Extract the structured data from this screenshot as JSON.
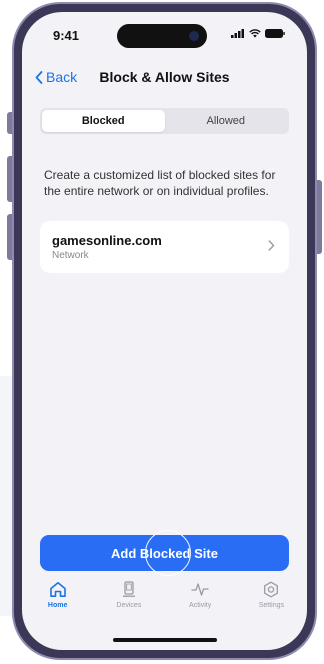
{
  "status_bar": {
    "time": "9:41"
  },
  "nav": {
    "back_label": "Back",
    "title": "Block & Allow Sites"
  },
  "segments": {
    "blocked_label": "Blocked",
    "allowed_label": "Allowed",
    "selected": "Blocked"
  },
  "description": "Create a customized list of blocked sites for the entire network or on individual profiles.",
  "blocked_sites": [
    {
      "domain": "gamesonline.com",
      "scope": "Network"
    }
  ],
  "add_button_label": "Add Blocked Site",
  "tabbar": {
    "tabs": [
      {
        "label": "Home",
        "icon": "home-icon",
        "active": true
      },
      {
        "label": "Devices",
        "icon": "devices-icon",
        "active": false
      },
      {
        "label": "Activity",
        "icon": "activity-icon",
        "active": false
      },
      {
        "label": "Settings",
        "icon": "settings-icon",
        "active": false
      }
    ]
  },
  "colors": {
    "accent": "#2a6df5",
    "link": "#1a73e8",
    "screen_bg": "#f2f2f7",
    "phone_frame": "#3b3757"
  }
}
